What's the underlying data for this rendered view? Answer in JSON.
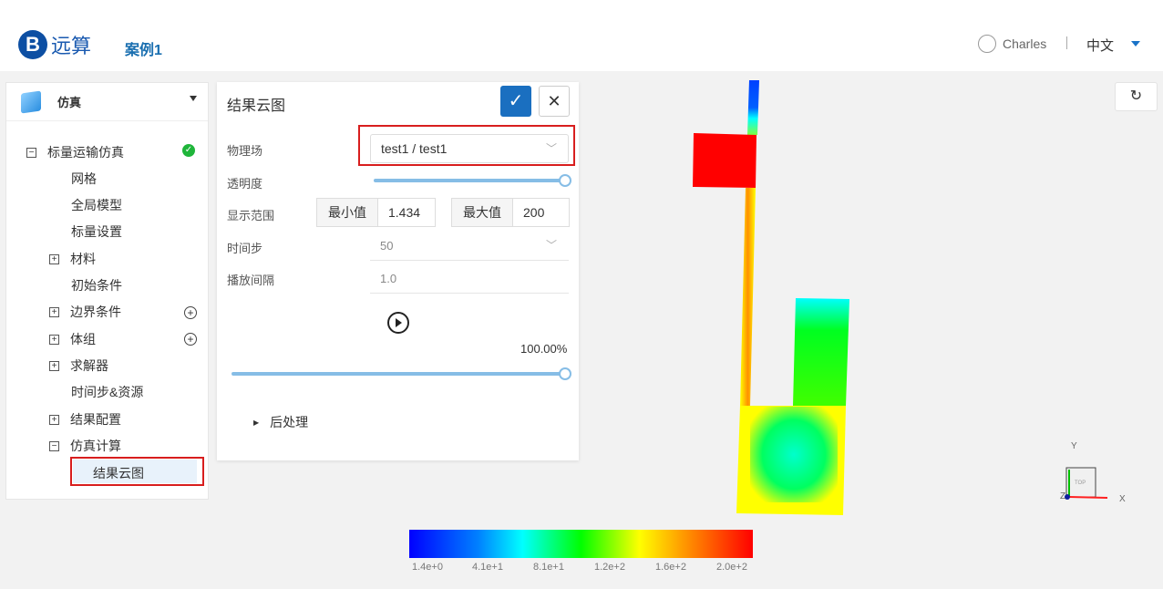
{
  "header": {
    "logo_letter": "B",
    "logo_text": "远算",
    "case_name": "案例1",
    "user": "Charles",
    "language": "中文"
  },
  "sidebar": {
    "title": "仿真",
    "items": [
      {
        "label": "标量运输仿真",
        "toggle": "−",
        "status": "complete"
      },
      {
        "label": "网格"
      },
      {
        "label": "全局模型"
      },
      {
        "label": "标量设置"
      },
      {
        "label": "材料",
        "toggle": "+"
      },
      {
        "label": "初始条件"
      },
      {
        "label": "边界条件",
        "toggle": "+",
        "add": true
      },
      {
        "label": "体组",
        "toggle": "+",
        "add": true
      },
      {
        "label": "求解器",
        "toggle": "+"
      },
      {
        "label": "时间步&资源"
      },
      {
        "label": "结果配置",
        "toggle": "+"
      },
      {
        "label": "仿真计算",
        "toggle": "−"
      },
      {
        "label": "结果云图",
        "selected": true
      }
    ]
  },
  "dialog": {
    "title": "结果云图",
    "field_label": "物理场",
    "field_value": "test1 / test1",
    "opacity_label": "透明度",
    "opacity": 1.0,
    "range_label": "显示范围",
    "min_label": "最小值",
    "min_value": "1.434",
    "max_label": "最大值",
    "max_value": "200",
    "timestep_label": "时间步",
    "timestep_value": "50",
    "interval_label": "播放间隔",
    "interval_value": "1.0",
    "progress_text": "100.00%",
    "progress": 1.0,
    "post_label": "后处理"
  },
  "colorbar": {
    "ticks": [
      "1.4e+0",
      "4.1e+1",
      "8.1e+1",
      "1.2e+2",
      "1.6e+2",
      "2.0e+2"
    ],
    "colors": [
      "#0000ff",
      "#00ffff",
      "#00ff00",
      "#ffff00",
      "#ff0000"
    ]
  },
  "axes": {
    "x": "X",
    "y": "Y",
    "z": "Z",
    "cube_face": "TOP"
  }
}
